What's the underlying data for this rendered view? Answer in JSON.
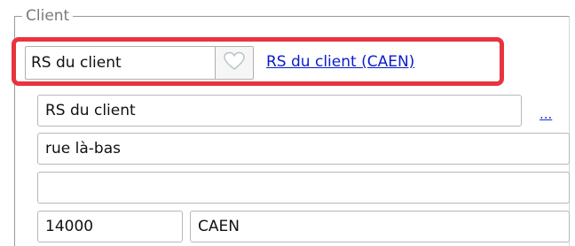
{
  "group": {
    "legend": "Client"
  },
  "client_select": {
    "value": "RS du client",
    "button_icon": "heart-icon"
  },
  "client_link": {
    "label": "RS du client (CAEN)"
  },
  "fields": {
    "name": "RS du client",
    "address1": "rue là-bas",
    "address2": "",
    "postal_code": "14000",
    "city": "CAEN"
  },
  "more_button": {
    "label": "..."
  },
  "colors": {
    "highlight": "#e8343f",
    "link": "#0a1ccc"
  }
}
